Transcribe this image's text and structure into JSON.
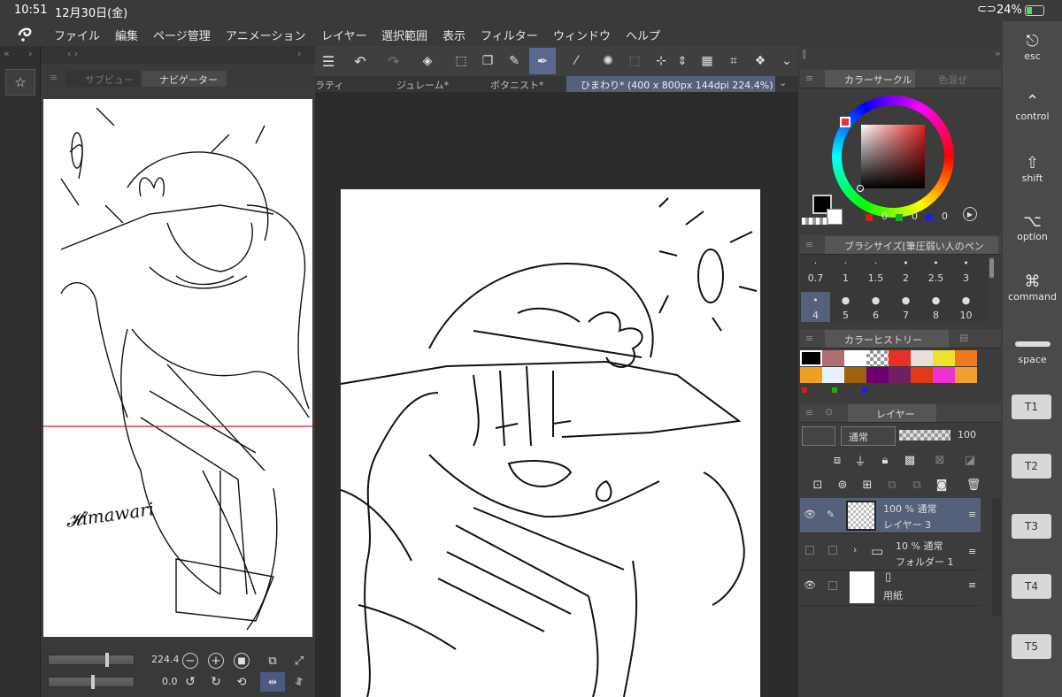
{
  "status": {
    "time": "10:51",
    "date": "12月30日(金)",
    "battery": "24%"
  },
  "menu": [
    "ファイル",
    "編集",
    "ページ管理",
    "アニメーション",
    "レイヤー",
    "選択範囲",
    "表示",
    "フィルター",
    "ウィンドウ",
    "ヘルプ"
  ],
  "nav": {
    "tab_subview": "サブビュー",
    "tab_navigator": "ナビゲーター",
    "zoom": "224.4",
    "rotate": "0.0"
  },
  "tabs": [
    "ラティ",
    "ジュレーム*",
    "ボタニスト*",
    "ひまわり* (400 x 800px 144dpi 224.4%)"
  ],
  "color": {
    "title": "カラーサークル",
    "title2": "色混ぜ",
    "r": "0",
    "g": "0",
    "b": "0",
    "fg": "#000000",
    "bg": "#ffffff"
  },
  "brush": {
    "title": "ブラシサイズ[筆圧弱い人のペン",
    "sizes": [
      "0.7",
      "1",
      "1.5",
      "2",
      "2.5",
      "3",
      "4",
      "5",
      "6",
      "7",
      "8",
      "10"
    ]
  },
  "history": {
    "title": "カラーヒストリー",
    "colors": [
      "#000000",
      "#b07070",
      "#ffffff",
      "checker",
      "#e8302a",
      "#e8e0d8",
      "#f0e030",
      "#f07820",
      "#f0a020",
      "#e8f0f8",
      "#a06010",
      "#700070",
      "#702060",
      "#e03a18",
      "#f030d0",
      "#f0a030"
    ]
  },
  "layer": {
    "title": "レイヤー",
    "blend": "通常",
    "opacity": "100",
    "rows": [
      {
        "mode": "100 % 通常",
        "name": "レイヤー 3"
      },
      {
        "mode": "10 % 通常",
        "name": "フォルダー 1"
      },
      {
        "mode": "",
        "name": "用紙"
      }
    ]
  },
  "mods": [
    "esc",
    "control",
    "shift",
    "option",
    "command",
    "space"
  ],
  "tkeys": [
    "T1",
    "T2",
    "T3",
    "T4",
    "T5"
  ],
  "signature": "Himawari"
}
